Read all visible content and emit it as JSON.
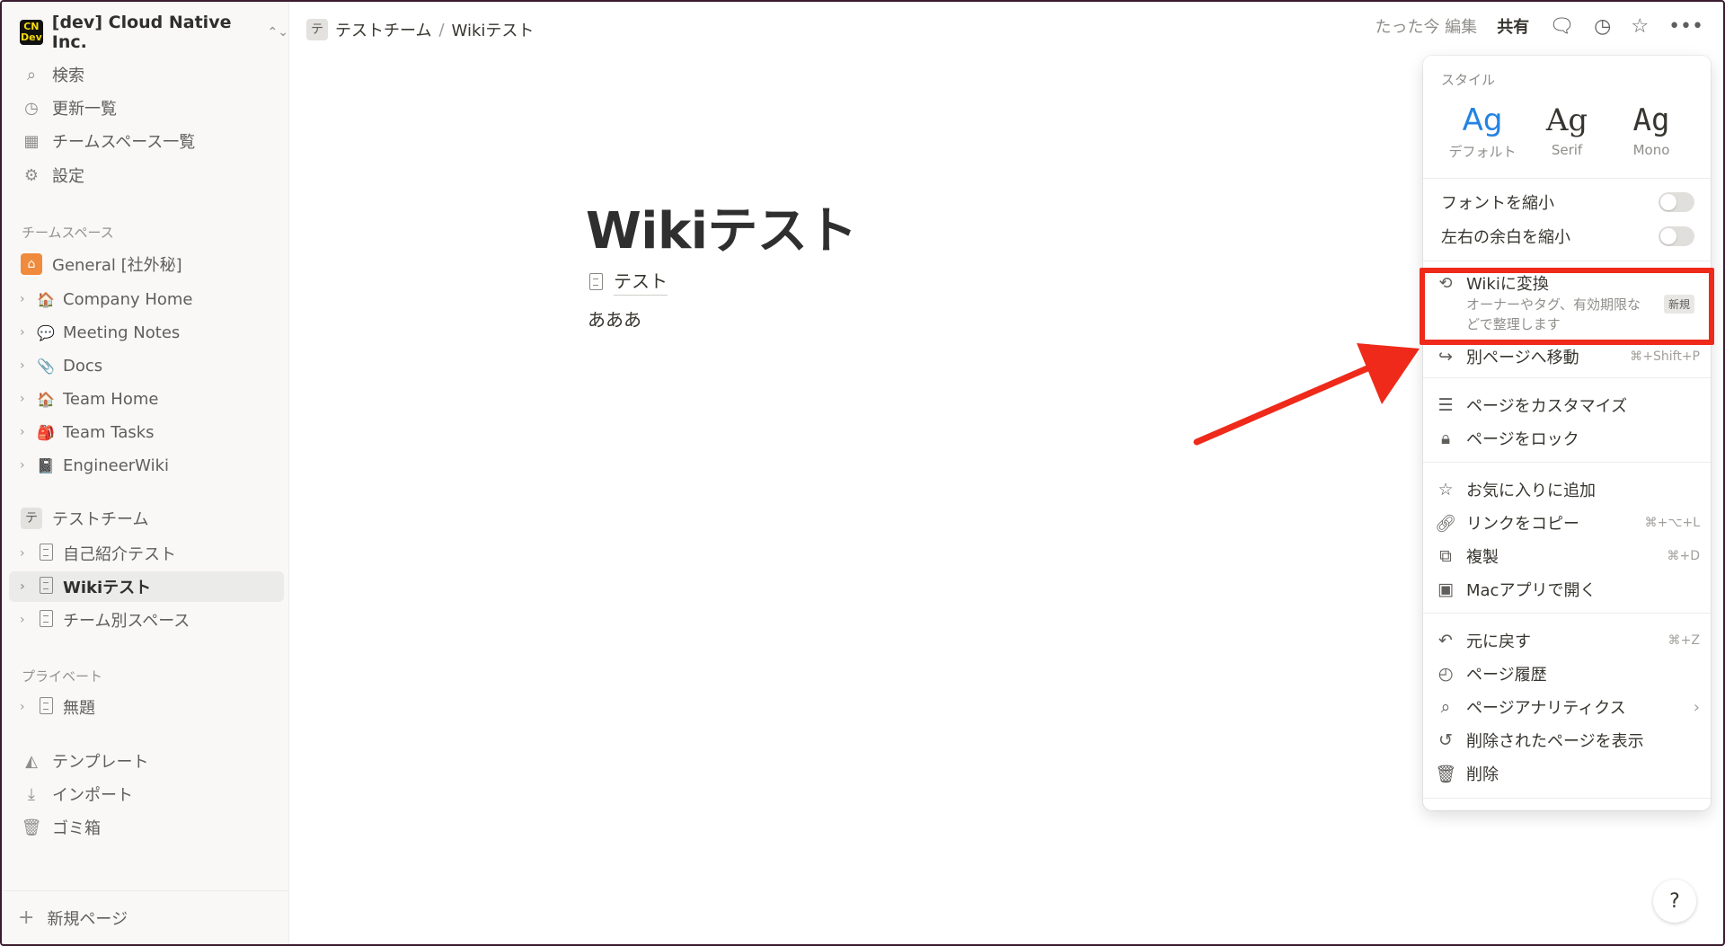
{
  "workspace": {
    "logo_text": "CN\nDev",
    "name": "[dev] Cloud Native Inc."
  },
  "sidebar": {
    "top_items": [
      {
        "label": "検索",
        "icon": "search-icon"
      },
      {
        "label": "更新一覧",
        "icon": "clock-icon"
      },
      {
        "label": "チームスペース一覧",
        "icon": "building-icon"
      },
      {
        "label": "設定",
        "icon": "gear-icon"
      }
    ],
    "teamspace_section": "チームスペース",
    "general": "General [社外秘]",
    "general_children": [
      {
        "label": "Company Home",
        "emoji": "🏠"
      },
      {
        "label": "Meeting Notes",
        "emoji": "💬"
      },
      {
        "label": "Docs",
        "emoji": "📎"
      },
      {
        "label": "Team Home",
        "emoji": "🏠"
      },
      {
        "label": "Team Tasks",
        "emoji": "🎒"
      },
      {
        "label": "EngineerWiki",
        "emoji": "📓"
      }
    ],
    "test_team": {
      "initial": "テ",
      "label": "テストチーム"
    },
    "test_team_children": [
      {
        "label": "自己紹介テスト"
      },
      {
        "label": "Wikiテスト",
        "selected": true
      },
      {
        "label": "チーム別スペース"
      }
    ],
    "private_section": "プライベート",
    "private_children": [
      {
        "label": "無題"
      }
    ],
    "bottom_items": [
      {
        "label": "テンプレート",
        "icon": "shapes-icon"
      },
      {
        "label": "インポート",
        "icon": "download-icon"
      },
      {
        "label": "ゴミ箱",
        "icon": "trash-icon"
      }
    ],
    "new_page": "新規ページ"
  },
  "topbar": {
    "breadcrumb_initial": "テ",
    "breadcrumb_team": "テストチーム",
    "breadcrumb_sep": "/",
    "breadcrumb_page": "Wikiテスト",
    "edited": "たった今 編集",
    "share": "共有"
  },
  "page": {
    "title": "Wikiテスト",
    "subpage": "テスト",
    "body": "あああ"
  },
  "menu": {
    "style_label": "スタイル",
    "styles": [
      {
        "glyph": "Ag",
        "name": "デフォルト",
        "active": true
      },
      {
        "glyph": "Ag",
        "name": "Serif"
      },
      {
        "glyph": "Ag",
        "name": "Mono"
      }
    ],
    "small_font": "フォントを縮小",
    "full_width": "左右の余白を縮小",
    "wiki": {
      "title": "Wikiに変換",
      "desc": "オーナーやタグ、有効期限などで整理します",
      "badge": "新規"
    },
    "move_to": {
      "label": "別ページへ移動",
      "shortcut": "⌘+Shift+P"
    },
    "customize": "ページをカスタマイズ",
    "lock": "ページをロック",
    "favorite": "お気に入りに追加",
    "copy_link": {
      "label": "リンクをコピー",
      "shortcut": "⌘+⌥+L"
    },
    "duplicate": {
      "label": "複製",
      "shortcut": "⌘+D"
    },
    "open_mac": "Macアプリで開く",
    "undo": {
      "label": "元に戻す",
      "shortcut": "⌘+Z"
    },
    "history": "ページ履歴",
    "analytics": "ページアナリティクス",
    "deleted": "削除されたページを表示",
    "delete": "削除"
  },
  "help": "?",
  "colors": {
    "accent": "#2383e2",
    "highlight": "#ef2a1a"
  }
}
